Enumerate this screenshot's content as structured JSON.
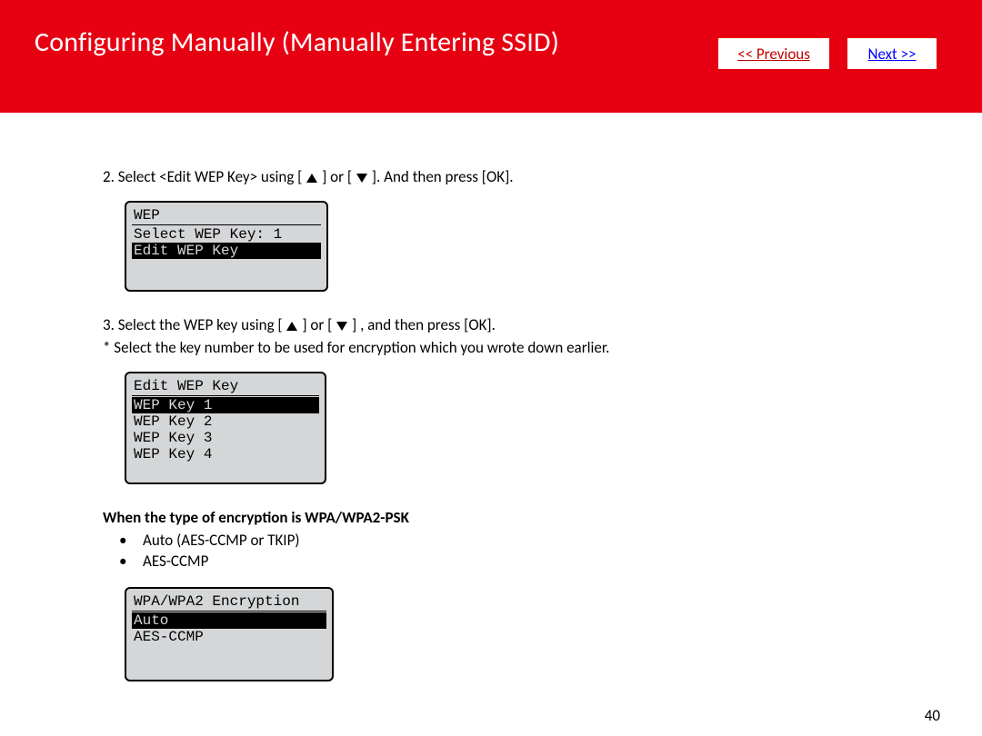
{
  "header": {
    "title": "Configuring Manually (Manually Entering SSID)",
    "prev": "<< Previous",
    "next": "Next >>"
  },
  "steps": {
    "s2a": "2. Select <Edit WEP Key> using [",
    "s2b": "] or [",
    "s2c": "]. And then press [OK].",
    "s3a": "3. Select the WEP key using [",
    "s3b": "] or [",
    "s3c": "] , and then press [OK].",
    "s3note": "* Select the key number to be used for encryption which you wrote down earlier."
  },
  "lcd1": {
    "title": "WEP",
    "row1": "Select WEP Key: 1",
    "row2": "Edit WEP Key"
  },
  "lcd2": {
    "title": "Edit WEP Key",
    "r1": "WEP Key 1",
    "r2": "WEP Key 2",
    "r3": "WEP Key 3",
    "r4": "WEP Key 4"
  },
  "wpa": {
    "heading": "When the type of encryption is WPA/WPA2-PSK",
    "b1": "Auto (AES-CCMP or TKIP)",
    "b2": "AES-CCMP"
  },
  "lcd3": {
    "title": "WPA/WPA2 Encryption",
    "r1": "Auto",
    "r2": "AES-CCMP"
  },
  "page_number": "40"
}
